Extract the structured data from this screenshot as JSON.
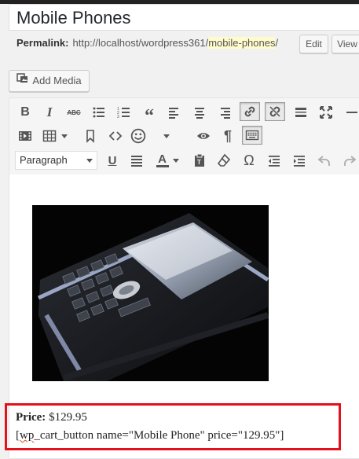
{
  "post": {
    "title": "Mobile Phones",
    "permalink_label": "Permalink:",
    "permalink_base": "http://localhost/wordpress361/",
    "permalink_slug": "mobile-phones",
    "permalink_trail": "/",
    "edit_label": "Edit",
    "view_label": "View"
  },
  "media": {
    "add_media_label": "Add Media"
  },
  "toolbar": {
    "format_value": "Paragraph",
    "row1_icons": [
      "bold-icon",
      "italic-icon",
      "strikethrough-icon",
      "bullet-list-icon",
      "numbered-list-icon",
      "blockquote-icon",
      "align-left-icon",
      "align-center-icon",
      "align-right-icon",
      "insert-link-icon",
      "unlink-icon",
      "read-more-icon",
      "fullscreen-icon",
      "horizontal-line-icon"
    ],
    "row2_icons": [
      "media-icon",
      "table-icon",
      "bookmark-icon",
      "code-icon",
      "emoji-icon",
      "preview-icon",
      "paragraph-mark-icon",
      "toolbar-toggle-icon"
    ],
    "row3_icons": [
      "underline-icon",
      "justify-icon",
      "text-color-icon",
      "paste-text-icon",
      "clear-format-icon",
      "special-char-icon",
      "outdent-icon",
      "indent-icon",
      "undo-icon",
      "redo-icon"
    ]
  },
  "content": {
    "image_alt": "mobile phone photo",
    "price_label": "Price:",
    "price_value": "$129.95",
    "shortcode_open": "[wp",
    "shortcode_rest": "_cart_button name=\"Mobile Phone\" price=\"129.95\"]"
  },
  "colors": {
    "highlight_border": "#e2111c",
    "slug_bg": "#fffbcc"
  }
}
